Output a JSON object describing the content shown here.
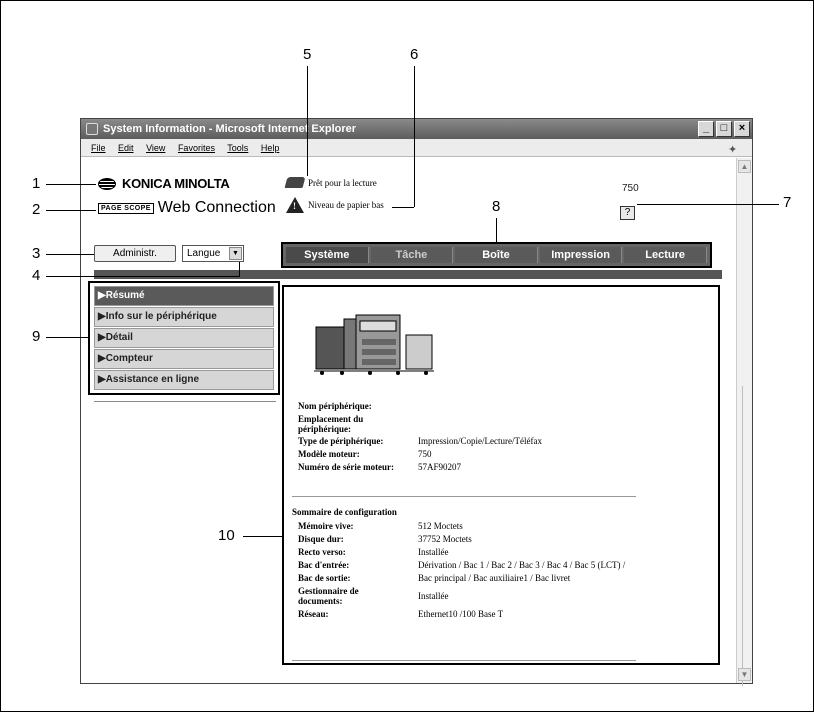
{
  "window": {
    "title": "System Information - Microsoft Internet Explorer",
    "menus": [
      "File",
      "Edit",
      "View",
      "Favorites",
      "Tools",
      "Help"
    ],
    "buttons": [
      "_",
      "□",
      "×"
    ]
  },
  "header": {
    "brand": "KONICA MINOLTA",
    "pagescope": "PAGE SCOPE",
    "web_connection": "Web Connection",
    "status_ready": "Prêt pour la lecture",
    "status_paper": "Niveau de papier bas",
    "model": "750",
    "help_label": "?"
  },
  "controls": {
    "admin_button": "Administr.",
    "language_select": "Langue"
  },
  "tabs": [
    {
      "label": "Système",
      "state": "active"
    },
    {
      "label": "Tâche",
      "state": "dim"
    },
    {
      "label": "Boîte",
      "state": "normal"
    },
    {
      "label": "Impression",
      "state": "normal"
    },
    {
      "label": "Lecture",
      "state": "normal"
    }
  ],
  "menu": [
    {
      "label": "▶Résumé",
      "active": true
    },
    {
      "label": "▶Info sur le périphérique",
      "active": false
    },
    {
      "label": "▶Détail",
      "active": false
    },
    {
      "label": "▶Compteur",
      "active": false
    },
    {
      "label": "▶Assistance en ligne",
      "active": false
    }
  ],
  "device_info": [
    {
      "label": "Nom périphérique:",
      "value": ""
    },
    {
      "label": "Emplacement du périphérique:",
      "value": ""
    },
    {
      "label": "Type de périphérique:",
      "value": "Impression/Copie/Lecture/Téléfax"
    },
    {
      "label": "Modèle moteur:",
      "value": "750"
    },
    {
      "label": "Numéro de série moteur:",
      "value": "57AF90207"
    }
  ],
  "config": {
    "title": "Sommaire de configuration",
    "rows": [
      {
        "label": "Mémoire vive:",
        "value": "512 Moctets"
      },
      {
        "label": "Disque dur:",
        "value": "37752 Moctets"
      },
      {
        "label": "Recto verso:",
        "value": "Installée"
      },
      {
        "label": "Bac d'entrée:",
        "value": "Dérivation / Bac 1 / Bac 2 / Bac 3 / Bac 4 / Bac 5 (LCT) /"
      },
      {
        "label": "Bac de sortie:",
        "value": "Bac principal / Bac auxiliaire1 / Bac livret"
      },
      {
        "label": "Gestionnaire de documents:",
        "value": "Installée"
      },
      {
        "label": "Réseau:",
        "value": "Ethernet10 /100 Base T"
      }
    ]
  },
  "callouts": [
    "1",
    "2",
    "3",
    "4",
    "5",
    "6",
    "7",
    "8",
    "9",
    "10"
  ],
  "colors": {
    "tab_bg": "#5a5a5a",
    "active_menu": "#5a5a5a",
    "titlebar": "#6e6e6e"
  }
}
